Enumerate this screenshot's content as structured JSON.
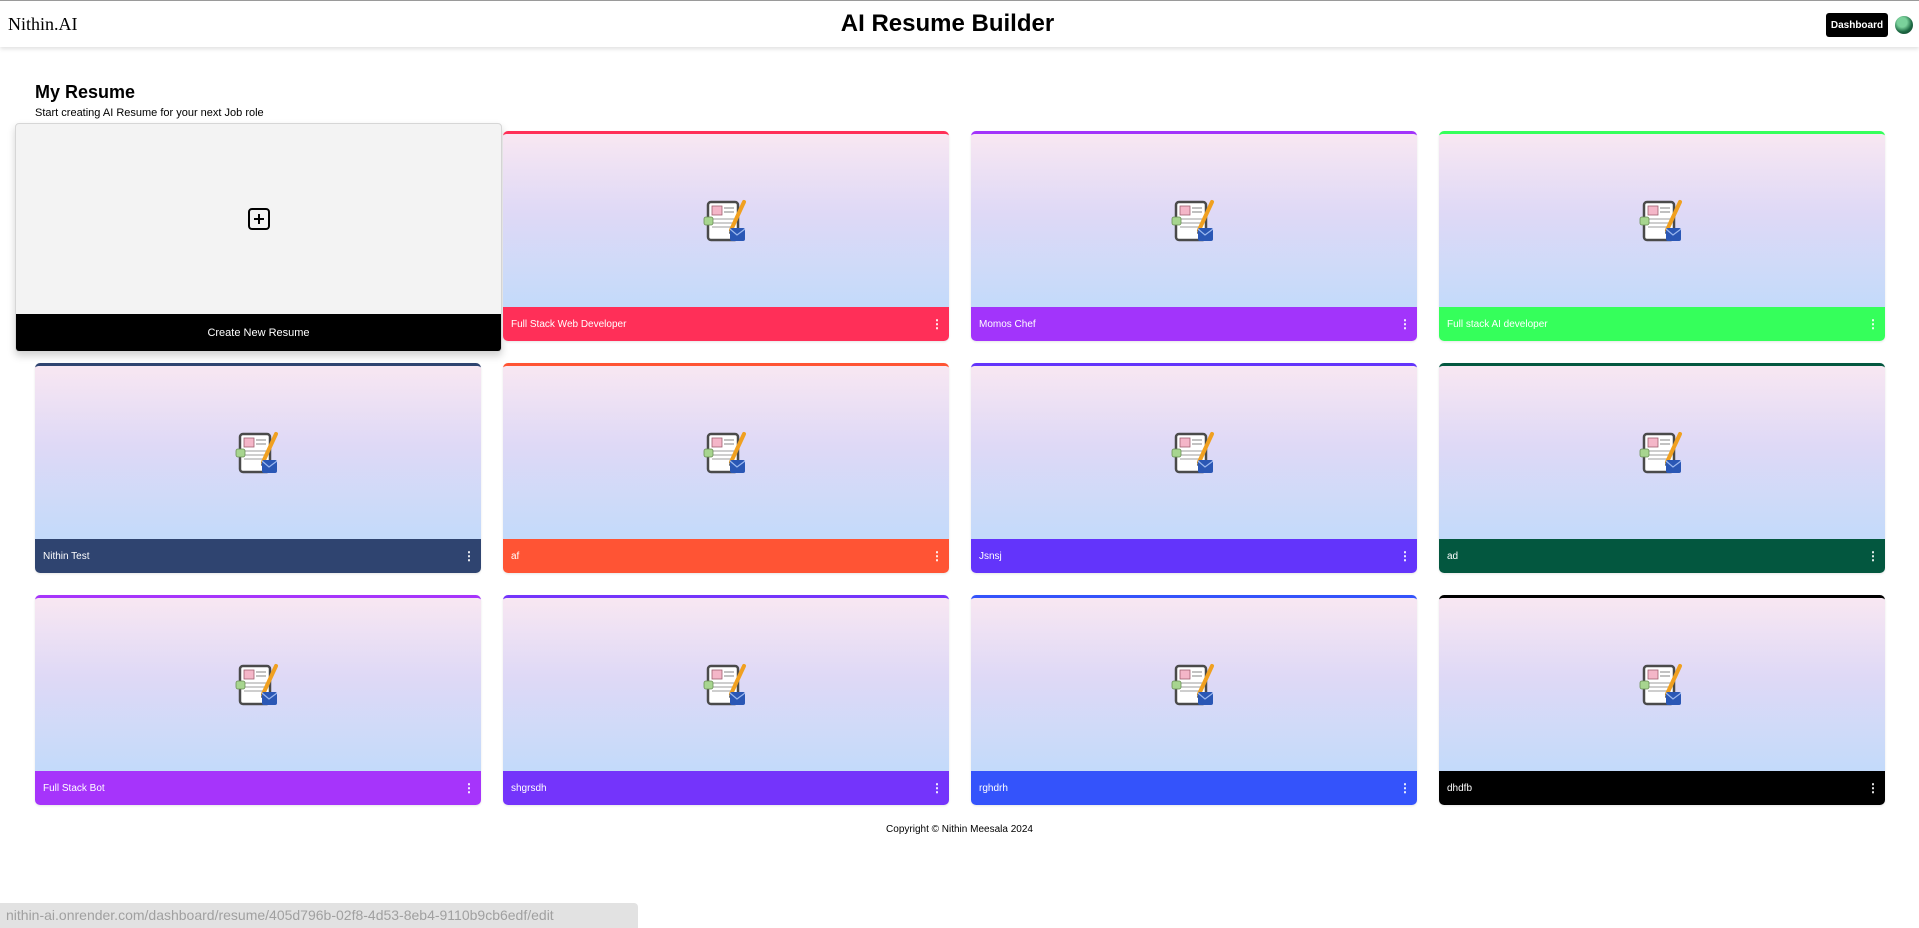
{
  "header": {
    "logo": "Nithin.AI",
    "title": "AI Resume Builder",
    "dashboard_label": "Dashboard"
  },
  "page": {
    "heading": "My Resume",
    "subheading": "Start creating AI Resume for your next Job role"
  },
  "create_card": {
    "label": "Create New Resume"
  },
  "resumes": [
    {
      "title": "Full Stack Web Developer",
      "color": "#ff2f58"
    },
    {
      "title": "Momos Chef",
      "color": "#a234fb"
    },
    {
      "title": "Full stack AI developer",
      "color": "#35ff5b"
    },
    {
      "title": "Nithin Test",
      "color": "#2f4470"
    },
    {
      "title": "af",
      "color": "#ff5434"
    },
    {
      "title": "Jsnsj",
      "color": "#6334fb"
    },
    {
      "title": "ad",
      "color": "#03573f"
    },
    {
      "title": "Full Stack Bot",
      "color": "#a634fb"
    },
    {
      "title": "shgrsdh",
      "color": "#7434fb"
    },
    {
      "title": "rghdrh",
      "color": "#3453fb"
    },
    {
      "title": "dhdfb",
      "color": "#000000"
    }
  ],
  "footer": {
    "copyright": "Copyright © Nithin Meesala 2024"
  },
  "status_bar": {
    "url": "nithin-ai.onrender.com/dashboard/resume/405d796b-02f8-4d53-8eb4-9110b9cb6edf/edit"
  },
  "icons": {
    "add": "plus-square-icon",
    "resume": "resume-document-icon",
    "menu": "more-vertical-icon"
  }
}
